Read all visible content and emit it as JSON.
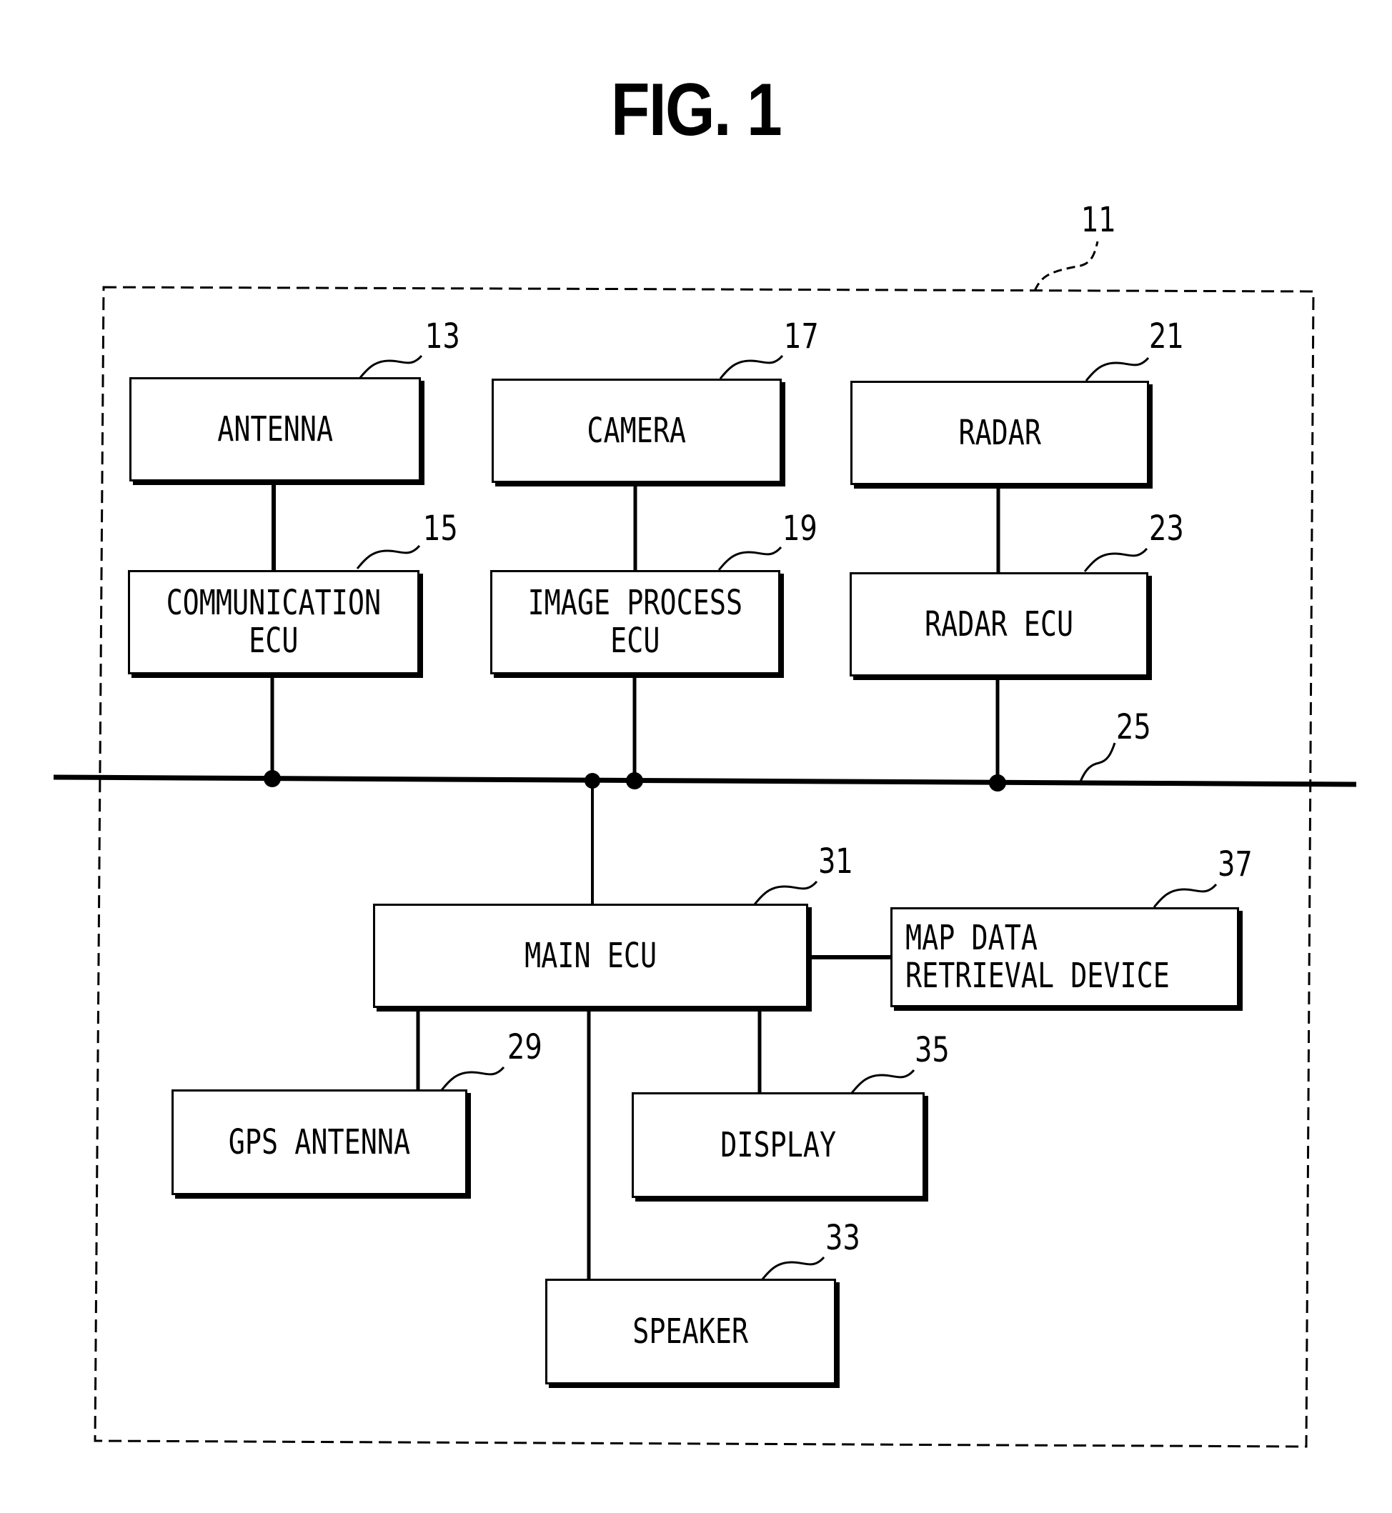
{
  "figure_title": "FIG. 1",
  "system": {
    "ref": "11"
  },
  "bus": {
    "ref": "25"
  },
  "blocks": [
    {
      "id": "antenna",
      "label": "ANTENNA",
      "ref": "13"
    },
    {
      "id": "communication-ecu",
      "label": "COMMUNICATION\nECU",
      "ref": "15"
    },
    {
      "id": "camera",
      "label": "CAMERA",
      "ref": "17"
    },
    {
      "id": "image-process-ecu",
      "label": "IMAGE PROCESS\nECU",
      "ref": "19"
    },
    {
      "id": "radar",
      "label": "RADAR",
      "ref": "21"
    },
    {
      "id": "radar-ecu",
      "label": "RADAR ECU",
      "ref": "23"
    },
    {
      "id": "gps-antenna",
      "label": "GPS ANTENNA",
      "ref": "29"
    },
    {
      "id": "main-ecu",
      "label": "MAIN ECU",
      "ref": "31"
    },
    {
      "id": "speaker",
      "label": "SPEAKER",
      "ref": "33"
    },
    {
      "id": "display",
      "label": "DISPLAY",
      "ref": "35"
    },
    {
      "id": "map-data-retrieval-device",
      "label": "MAP DATA\nRETRIEVAL DEVICE",
      "ref": "37"
    }
  ],
  "connections": [
    [
      "antenna",
      "communication-ecu"
    ],
    [
      "camera",
      "image-process-ecu"
    ],
    [
      "radar",
      "radar-ecu"
    ],
    [
      "communication-ecu",
      "bus"
    ],
    [
      "image-process-ecu",
      "bus"
    ],
    [
      "radar-ecu",
      "bus"
    ],
    [
      "main-ecu",
      "bus"
    ],
    [
      "main-ecu",
      "map-data-retrieval-device"
    ],
    [
      "main-ecu",
      "gps-antenna"
    ],
    [
      "main-ecu",
      "speaker"
    ],
    [
      "main-ecu",
      "display"
    ]
  ]
}
